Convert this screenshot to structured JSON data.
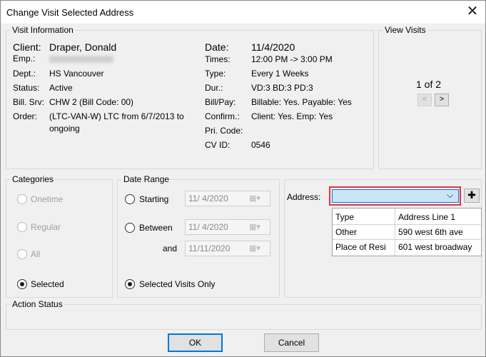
{
  "window": {
    "title": "Change Visit Selected Address",
    "close_glyph": "✕"
  },
  "visit_info": {
    "group_label": "Visit Information",
    "client_label": "Client:",
    "client_value": "Draper, Donald",
    "emp_label": "Emp.:",
    "dept_label": "Dept.:",
    "dept_value": "HS Vancouver",
    "status_label": "Status:",
    "status_value": "Active",
    "billsrv_label": "Bill. Srv:",
    "billsrv_value": "CHW 2 (Bill Code: 00)",
    "order_label": "Order:",
    "order_value_line1": "(LTC-VAN-W) LTC from 6/7/2013 to",
    "order_value_line2": "ongoing",
    "date_label": "Date:",
    "date_value": "11/4/2020",
    "times_label": "Times:",
    "times_value": "12:00 PM -> 3:00 PM",
    "type_label": "Type:",
    "type_value": "Every 1 Weeks",
    "dur_label": "Dur.:",
    "dur_value": "VD:3  BD:3  PD:3",
    "billpay_label": "Bill/Pay:",
    "billpay_value": "Billable: Yes. Payable: Yes",
    "confirm_label": "Confirm.:",
    "confirm_value": "Client: Yes. Emp: Yes",
    "pricode_label": "Pri. Code:",
    "cvid_label": "CV ID:",
    "cvid_value": "0546"
  },
  "view_visits": {
    "group_label": "View Visits",
    "counter": "1 of 2",
    "prev_glyph": "<",
    "next_glyph": ">"
  },
  "categories": {
    "group_label": "Categories",
    "items": [
      {
        "label": "Onetime",
        "selected": false,
        "enabled": false
      },
      {
        "label": "Regular",
        "selected": false,
        "enabled": false
      },
      {
        "label": "All",
        "selected": false,
        "enabled": false
      },
      {
        "label": "Selected",
        "selected": true,
        "enabled": true
      }
    ]
  },
  "date_range": {
    "group_label": "Date Range",
    "starting_label": "Starting",
    "starting_date": "11/  4/2020",
    "between_label": "Between",
    "between_date": "11/  4/2020",
    "and_label": "and",
    "and_date": "11/11/2020",
    "selected_visits_label": "Selected Visits Only",
    "calendar_glyph": "▦▾"
  },
  "address": {
    "label": "Address:",
    "dropdown_glyph": "⌵",
    "add_glyph": "✚",
    "grid": {
      "headers": [
        "Type",
        "Address Line 1"
      ],
      "rows": [
        [
          "Other",
          "590 west 6th ave"
        ],
        [
          "Place of Resi",
          "601 west broadway"
        ]
      ]
    }
  },
  "action_status": {
    "group_label": "Action Status"
  },
  "buttons": {
    "ok": "OK",
    "cancel": "Cancel"
  }
}
